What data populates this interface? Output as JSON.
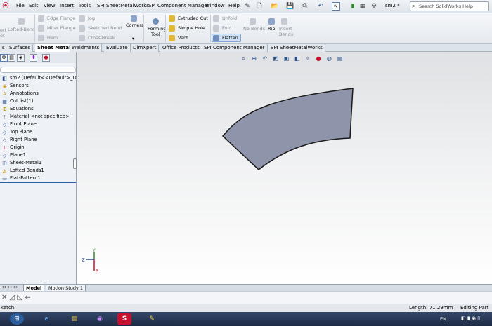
{
  "menubar": {
    "items": [
      "File",
      "Edit",
      "View",
      "Insert",
      "Tools",
      "SPI SheetMetalWorks",
      "SPI Component Manager",
      "Window",
      "Help"
    ],
    "doc_title": "sm2 *",
    "search_placeholder": "Search SolidWorks Help"
  },
  "ribbon": {
    "left_partial": [
      "ert",
      "et"
    ],
    "lofted_bend": "Lofted-Bend",
    "group1": [
      "Edge Flange",
      "Miter Flange",
      "Hem"
    ],
    "group2": [
      "Jog",
      "Sketched Bend",
      "Cross-Break"
    ],
    "corners": "Corners",
    "forming_tool": [
      "Forming",
      "Tool"
    ],
    "group3": [
      "Extruded Cut",
      "Simple Hole",
      "Vent"
    ],
    "group4": [
      "Unfold",
      "Fold",
      "Flatten"
    ],
    "no_bends": "No Bends",
    "rip": "Rip",
    "insert_bends": [
      "Insert",
      "Bends"
    ]
  },
  "command_tabs": [
    "s",
    "Surfaces",
    "Sheet Metal",
    "Weldments",
    "Evaluate",
    "DimXpert",
    "Office Products",
    "SPI Component Manager",
    "SPI SheetMetalWorks"
  ],
  "active_tab": "Sheet Metal",
  "tree": {
    "root": "sm2  (Default<<Default>_Displa",
    "items": [
      "Sensors",
      "Annotations",
      "Cut list(1)",
      "Equations",
      "Material <not specified>",
      "Front Plane",
      "Top Plane",
      "Right Plane",
      "Origin",
      "Plane1",
      "Sheet-Metal1",
      "Lofted Bends1",
      "Flat-Pattern1"
    ]
  },
  "bottom_tabs": [
    "Model",
    "Motion Study 1"
  ],
  "status": {
    "left": "ketch.",
    "length": "Length: 71.29mm",
    "mode": "Editing Part"
  },
  "triad": {
    "z": "Z",
    "y": "Y",
    "x": "X"
  },
  "taskbar": {
    "lang": "EN"
  },
  "colors": {
    "part_fill": "#8e94a9",
    "accent": "#305c9c"
  }
}
